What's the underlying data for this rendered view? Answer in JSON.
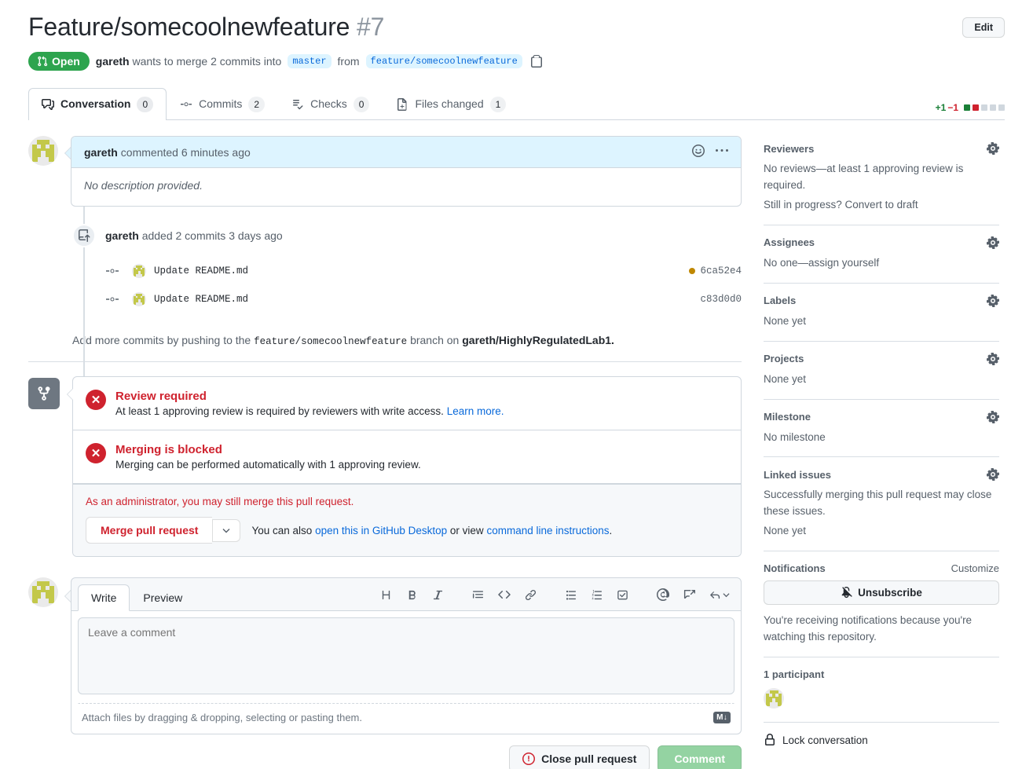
{
  "header": {
    "title": "Feature/somecoolnewfeature",
    "number": "#7",
    "edit_label": "Edit",
    "state": "Open",
    "author": "gareth",
    "sub_prefix": "wants to merge 2 commits into",
    "base_branch": "master",
    "from_word": "from",
    "head_branch": "feature/somecoolnewfeature"
  },
  "tabs": [
    {
      "label": "Conversation",
      "count": "0",
      "icon": "comment-discussion-icon",
      "selected": true
    },
    {
      "label": "Commits",
      "count": "2",
      "icon": "git-commit-icon",
      "selected": false
    },
    {
      "label": "Checks",
      "count": "0",
      "icon": "checklist-icon",
      "selected": false
    },
    {
      "label": "Files changed",
      "count": "1",
      "icon": "file-diff-icon",
      "selected": false
    }
  ],
  "diffstat": {
    "additions": "+1",
    "deletions": "−1",
    "blocks": [
      "#1a7f37",
      "#cf222e",
      "#d0d7de",
      "#d0d7de",
      "#d0d7de"
    ]
  },
  "comment": {
    "author": "gareth",
    "action": "commented",
    "time": "6 minutes ago",
    "body": "No description provided."
  },
  "timeline": {
    "push_event": {
      "author": "gareth",
      "text": "added 2 commits",
      "time": "3 days ago"
    },
    "commits": [
      {
        "message": "Update README.md",
        "sha": "6ca52e4",
        "status_dot": "#bf8700"
      },
      {
        "message": "Update README.md",
        "sha": "c83d0d0",
        "status_dot": ""
      }
    ],
    "push_note": {
      "prefix": "Add more commits by pushing to the",
      "branch": "feature/somecoolnewfeature",
      "middle": "branch on",
      "repo": "gareth/HighlyRegulatedLab1."
    }
  },
  "merge_status": {
    "rows": [
      {
        "title": "Review required",
        "desc": "At least 1 approving review is required by reviewers with write access.",
        "link": "Learn more."
      },
      {
        "title": "Merging is blocked",
        "desc": "Merging can be performed automatically with 1 approving review.",
        "link": ""
      }
    ],
    "admin_note": "As an administrator, you may still merge this pull request.",
    "merge_button": "Merge pull request",
    "alt_prefix": "You can also",
    "alt_link1": "open this in GitHub Desktop",
    "alt_middle": "or view",
    "alt_link2": "command line instructions",
    "alt_suffix": "."
  },
  "editor": {
    "tabs": {
      "write": "Write",
      "preview": "Preview"
    },
    "placeholder": "Leave a comment",
    "attach_text": "Attach files by dragging & dropping, selecting or pasting them.",
    "markdown_badge": "M↓",
    "close_button": "Close pull request",
    "comment_button": "Comment",
    "toolbar": [
      "heading-icon",
      "bold-icon",
      "italic-icon",
      "quote-icon",
      "code-icon",
      "link-icon",
      "unordered-list-icon",
      "ordered-list-icon",
      "task-list-icon",
      "mention-icon",
      "reference-icon",
      "reply-icon"
    ]
  },
  "sidebar": {
    "reviewers": {
      "title": "Reviewers",
      "line1": "No reviews—at least 1 approving review is required.",
      "line2": "Still in progress? Convert to draft"
    },
    "assignees": {
      "title": "Assignees",
      "line1": "No one—assign yourself"
    },
    "labels": {
      "title": "Labels",
      "line1": "None yet"
    },
    "projects": {
      "title": "Projects",
      "line1": "None yet"
    },
    "milestone": {
      "title": "Milestone",
      "line1": "No milestone"
    },
    "linked_issues": {
      "title": "Linked issues",
      "line1": "Successfully merging this pull request may close these issues.",
      "line2": "None yet"
    },
    "notifications": {
      "title": "Notifications",
      "customize": "Customize",
      "button": "Unsubscribe",
      "desc": "You're receiving notifications because you're watching this repository."
    },
    "participants": {
      "title": "1 participant"
    },
    "lock": {
      "label": "Lock conversation"
    }
  }
}
